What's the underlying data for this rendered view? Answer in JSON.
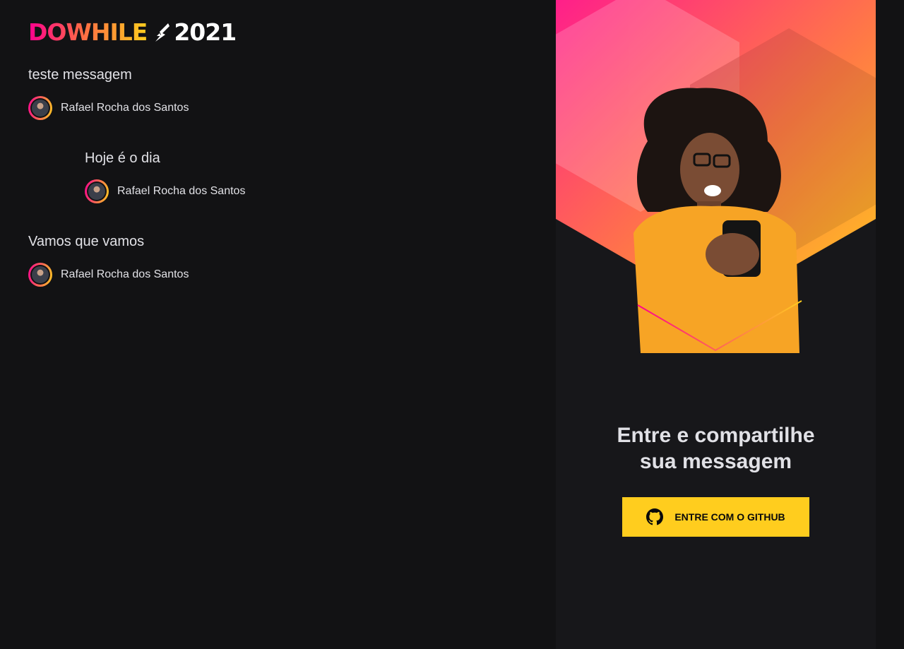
{
  "brand": {
    "name": "DOWHILE",
    "year": "2021"
  },
  "messages": [
    {
      "text": "teste messagem",
      "user": "Rafael Rocha dos Santos",
      "indented": false
    },
    {
      "text": "Hoje é o dia",
      "user": "Rafael Rocha dos Santos",
      "indented": true
    },
    {
      "text": "Vamos que vamos",
      "user": "Rafael Rocha dos Santos",
      "indented": false
    }
  ],
  "login": {
    "headline_line1": "Entre e compartilhe",
    "headline_line2": "sua messagem",
    "button_label": "ENTRE COM O GITHUB"
  },
  "icons": {
    "button_icon": "github-icon",
    "logo_mark": "rocket-icon"
  },
  "colors": {
    "background": "#121214",
    "panel": "#17171a",
    "accent_pink": "#ff008e",
    "accent_yellow": "#ffcd1e",
    "text": "#e1e1e6"
  }
}
